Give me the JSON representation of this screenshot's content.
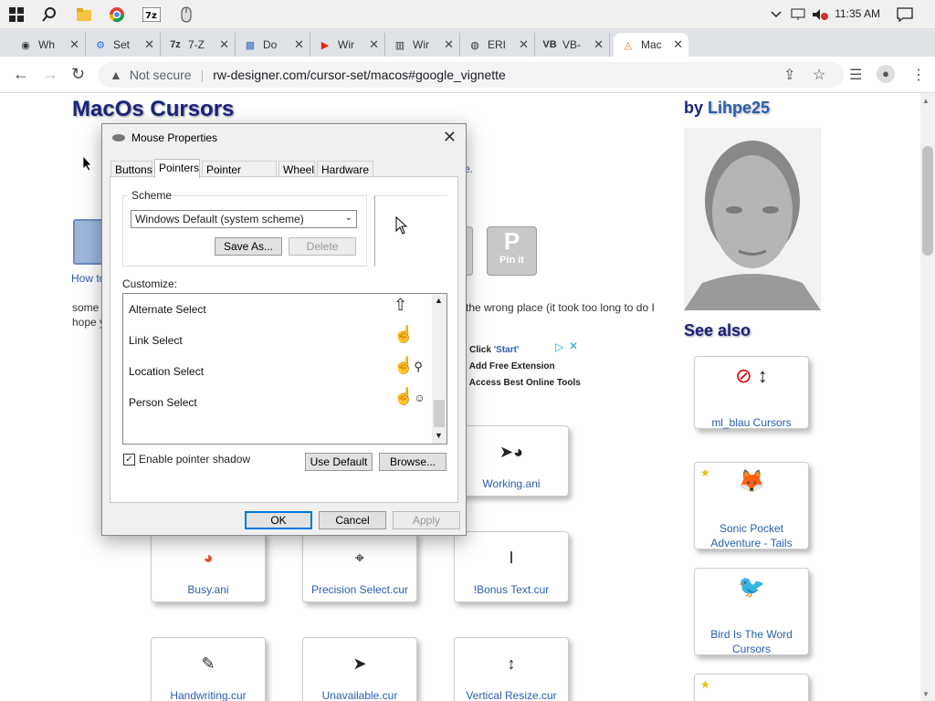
{
  "taskbar": {
    "time": "11:35 AM"
  },
  "browser": {
    "tabs": [
      {
        "label": "Wh"
      },
      {
        "label": "Set"
      },
      {
        "label": "7-Z"
      },
      {
        "label": "Do"
      },
      {
        "label": "Wir"
      },
      {
        "label": "Wir"
      },
      {
        "label": "ERI"
      },
      {
        "label": "VB-"
      },
      {
        "label": "Mac"
      }
    ],
    "not_secure": "Not secure",
    "url": "rw-designer.com/cursor-set/macos#google_vignette"
  },
  "page": {
    "title": "MacOs Cursors",
    "by_label": "by",
    "author": "Lihpe25",
    "see_also": "See also",
    "how_to": "How to",
    "body_left_1": "some",
    "body_left_2": "hope y",
    "body_right": "the wrong place (it took too long to do I",
    "link_fragment": "e.",
    "pin_label": "Pin it",
    "ad": [
      {
        "prefix": ") Click ",
        "highlight": "'Start'"
      },
      {
        "prefix": ") Add Free Extension",
        "highlight": ""
      },
      {
        "prefix": ") Access Best Online Tools",
        "highlight": ""
      }
    ],
    "cursors": [
      {
        "name": "Working.ani"
      },
      {
        "name": "Busy.ani"
      },
      {
        "name": "Precision Select.cur"
      },
      {
        "name": "!Bonus Text.cur"
      },
      {
        "name": "Handwriting.cur"
      },
      {
        "name": "Unavailable.cur"
      },
      {
        "name": "Vertical Resize.cur"
      }
    ],
    "see_also_items": [
      {
        "name": "ml_blau Cursors"
      },
      {
        "name": "Sonic Pocket Adventure - Tails"
      },
      {
        "name": "Bird Is The Word Cursors"
      }
    ]
  },
  "dialog": {
    "title": "Mouse Properties",
    "tabs": [
      "Buttons",
      "Pointers",
      "Pointer Options",
      "Wheel",
      "Hardware"
    ],
    "active_tab": "Pointers",
    "scheme_label": "Scheme",
    "scheme_value": "Windows Default (system scheme)",
    "save_as": "Save As...",
    "delete": "Delete",
    "customize_label": "Customize:",
    "list": [
      {
        "name": "Alternate Select"
      },
      {
        "name": "Link Select"
      },
      {
        "name": "Location Select"
      },
      {
        "name": "Person Select"
      }
    ],
    "shadow_label": "Enable pointer shadow",
    "use_default": "Use Default",
    "browse": "Browse...",
    "ok": "OK",
    "cancel": "Cancel",
    "apply": "Apply"
  }
}
